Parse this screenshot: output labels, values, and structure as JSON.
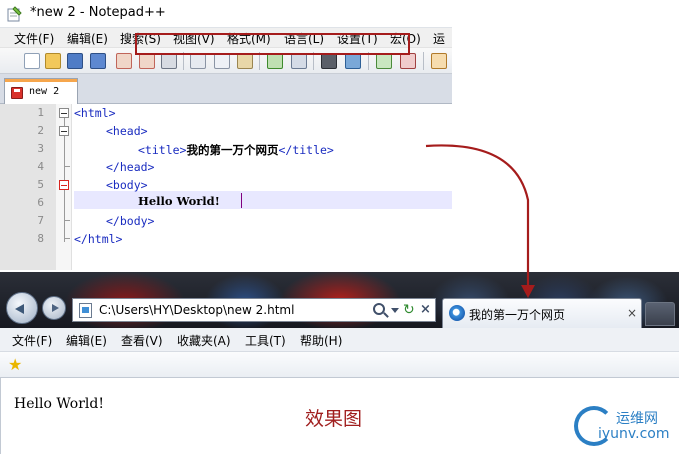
{
  "notepad": {
    "title": "*new  2 - Notepad++",
    "menu": [
      "文件(F)",
      "编辑(E)",
      "搜索(S)",
      "视图(V)",
      "格式(M)",
      "语言(L)",
      "设置(T)",
      "宏(O)",
      "运行"
    ],
    "tab_label": "new  2",
    "line_numbers": [
      "1",
      "2",
      "3",
      "4",
      "5",
      "6",
      "7",
      "8"
    ],
    "code": {
      "l1_tag": "<html>",
      "l2_tag": "<head>",
      "l3_open": "<title>",
      "l3_text": "我的第一万个网页",
      "l3_close": "</title>",
      "l4_tag": "</head>",
      "l5_tag": "<body>",
      "l6_text": "Hello World!",
      "l7_tag": "</body>",
      "l8_tag": "</html>"
    }
  },
  "browser": {
    "address_url": "C:\\Users\\HY\\Desktop\\new  2.html",
    "tab_title": "我的第一万个网页",
    "tab_close": "×",
    "refresh_glyph": "↻",
    "stop_glyph": "×",
    "menu": [
      "文件(F)",
      "编辑(E)",
      "查看(V)",
      "收藏夹(A)",
      "工具(T)",
      "帮助(H)"
    ],
    "page_text": "Hello World!"
  },
  "caption": "效果图",
  "watermark": {
    "cn": "运维网",
    "en": "iyunv.com"
  },
  "colors": {
    "annotation_red": "#a51c1c",
    "tag_blue": "#1a2cc0"
  }
}
